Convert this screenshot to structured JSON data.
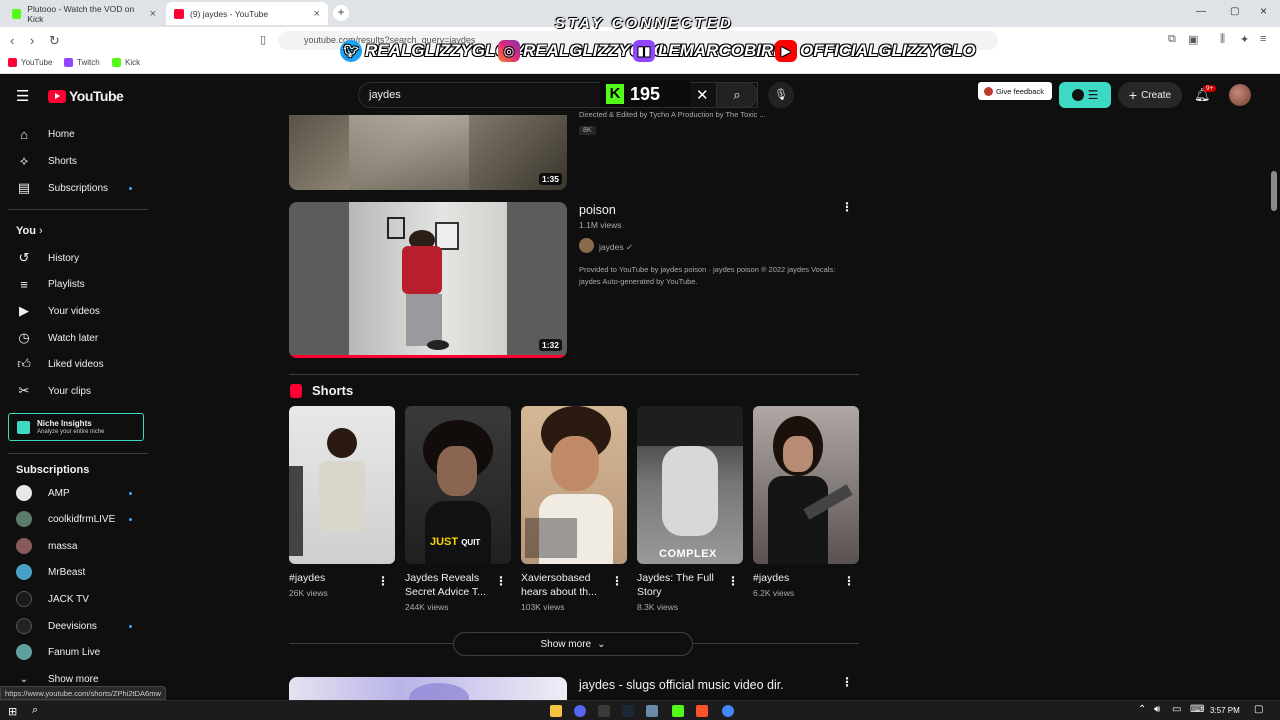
{
  "browser": {
    "tabs": [
      {
        "label": "Plutooo - Watch the VOD on Kick",
        "color": "#53fc18"
      },
      {
        "label": "(9) jaydes - YouTube",
        "color": "#ff0033"
      }
    ],
    "url": "youtube.com/results?search_query=jaydes",
    "bookmarks": [
      {
        "label": "YouTube",
        "color": "#ff0033"
      },
      {
        "label": "Twitch",
        "color": "#9146ff"
      },
      {
        "label": "Kick",
        "color": "#53fc18"
      }
    ],
    "status_url": "https://www.youtube.com/shorts/ZPhi2tDA6mw"
  },
  "overlay": {
    "title": "STAY CONNECTED",
    "handles": [
      {
        "icon": "twitter-icon",
        "text": "REALGLIZZYGLO74"
      },
      {
        "icon": "instagram-icon",
        "text": "REALGLIZZYGLO"
      },
      {
        "icon": "twitch-icon",
        "text": "LEMARCOBIRD"
      },
      {
        "icon": "youtube-icon",
        "text": "OFFICIALGLIZZYGLO"
      }
    ],
    "kick_viewers": "195"
  },
  "masthead": {
    "logo": "YouTube",
    "search_value": "jaydes",
    "feedback": "Give feedback",
    "create": "Create",
    "notif_badge": "9+"
  },
  "sidebar": {
    "main": [
      {
        "icon": "home-icon",
        "label": "Home"
      },
      {
        "icon": "shorts-icon",
        "label": "Shorts"
      },
      {
        "icon": "subscriptions-icon",
        "label": "Subscriptions"
      }
    ],
    "you_header": "You",
    "you": [
      {
        "icon": "history-icon",
        "label": "History"
      },
      {
        "icon": "playlists-icon",
        "label": "Playlists"
      },
      {
        "icon": "your-videos-icon",
        "label": "Your videos"
      },
      {
        "icon": "watch-later-icon",
        "label": "Watch later"
      },
      {
        "icon": "liked-icon",
        "label": "Liked videos"
      },
      {
        "icon": "clips-icon",
        "label": "Your clips"
      }
    ],
    "niche": {
      "title": "Niche Insights",
      "subtitle": "Analyze your entire niche"
    },
    "subs_header": "Subscriptions",
    "subs": [
      {
        "label": "AMP",
        "dot": true,
        "color": "#e8e8e8"
      },
      {
        "label": "coolkidfrmLIVE",
        "dot": true,
        "color": "#5a7a6a"
      },
      {
        "label": "massa",
        "dot": false,
        "color": "#8a5a5a"
      },
      {
        "label": "MrBeast",
        "dot": false,
        "color": "#4aa0c8"
      },
      {
        "label": "JACK TV",
        "dot": false,
        "color": "#1a1a1a"
      },
      {
        "label": "Deevisions",
        "dot": true,
        "color": "#222222"
      },
      {
        "label": "Fanum Live",
        "dot": false,
        "color": "#5fa0a0"
      }
    ],
    "show_more": "Show more"
  },
  "results": {
    "top_video": {
      "duration": "1:35",
      "desc": "Directed & Edited by Tycho A Production by The Toxic ...",
      "badge": "8K"
    },
    "video2": {
      "title": "poison",
      "views": "1.1M views",
      "channel": "jaydes",
      "desc_line1": "Provided to YouTube by jaydes poison · jaydes poison ℗ 2022 jaydes Vocals:",
      "desc_line2": "jaydes Auto-generated by YouTube.",
      "duration": "1:32"
    },
    "shorts_header": "Shorts",
    "shorts": [
      {
        "title_1": "#jaydes",
        "title_2": "",
        "views": "26K views",
        "bg": "#d8d8d8"
      },
      {
        "title_1": "Jaydes Reveals",
        "title_2": "Secret Advice T...",
        "views": "244K views",
        "bg": "#3a3a3a",
        "overlay": "JUST",
        "overlay2": "QUIT"
      },
      {
        "title_1": "Xaviersobased",
        "title_2": "hears about th...",
        "views": "103K views",
        "bg": "#c9a27a"
      },
      {
        "title_1": "Jaydes: The Full",
        "title_2": "Story",
        "views": "8.3K views",
        "bg": "#6a6a6a",
        "overlay": "COMPLEX"
      },
      {
        "title_1": "#jaydes",
        "title_2": "",
        "views": "6.2K views",
        "bg": "#7a7070"
      }
    ],
    "show_more": "Show more",
    "video3": {
      "title": "jaydes - slugs official music video dir."
    }
  },
  "taskbar": {
    "time": "3:57 PM"
  }
}
